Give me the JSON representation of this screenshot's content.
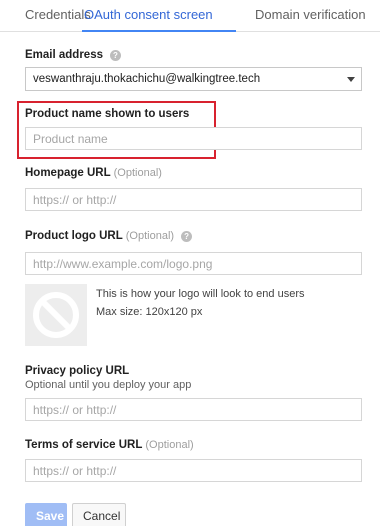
{
  "tabs": [
    {
      "label": "Credentials"
    },
    {
      "label": "OAuth consent screen"
    },
    {
      "label": "Domain verification"
    }
  ],
  "form": {
    "email": {
      "label": "Email address",
      "help": "?",
      "value": "veswanthraju.thokachichu@walkingtree.tech"
    },
    "product_name": {
      "label": "Product name shown to users",
      "placeholder": "Product name"
    },
    "homepage": {
      "label": "Homepage URL",
      "optional": "(Optional)",
      "placeholder": "https:// or http://"
    },
    "logo_url": {
      "label": "Product logo URL",
      "optional": "(Optional)",
      "help": "?",
      "placeholder": "http://www.example.com/logo.png"
    },
    "logo_preview": {
      "caption": "This is how your logo will look to end users",
      "max_size": "Max size: 120x120 px"
    },
    "privacy": {
      "label": "Privacy policy URL",
      "hint": "Optional until you deploy your app",
      "placeholder": "https:// or http://"
    },
    "terms": {
      "label": "Terms of service URL",
      "optional": "(Optional)",
      "placeholder": "https:// or http://"
    }
  },
  "actions": {
    "save_label": "Save",
    "cancel_label": "Cancel"
  },
  "colors": {
    "accent": "#4285f4",
    "highlight": "#d8222f",
    "save_disabled": "#a0bdf5"
  }
}
